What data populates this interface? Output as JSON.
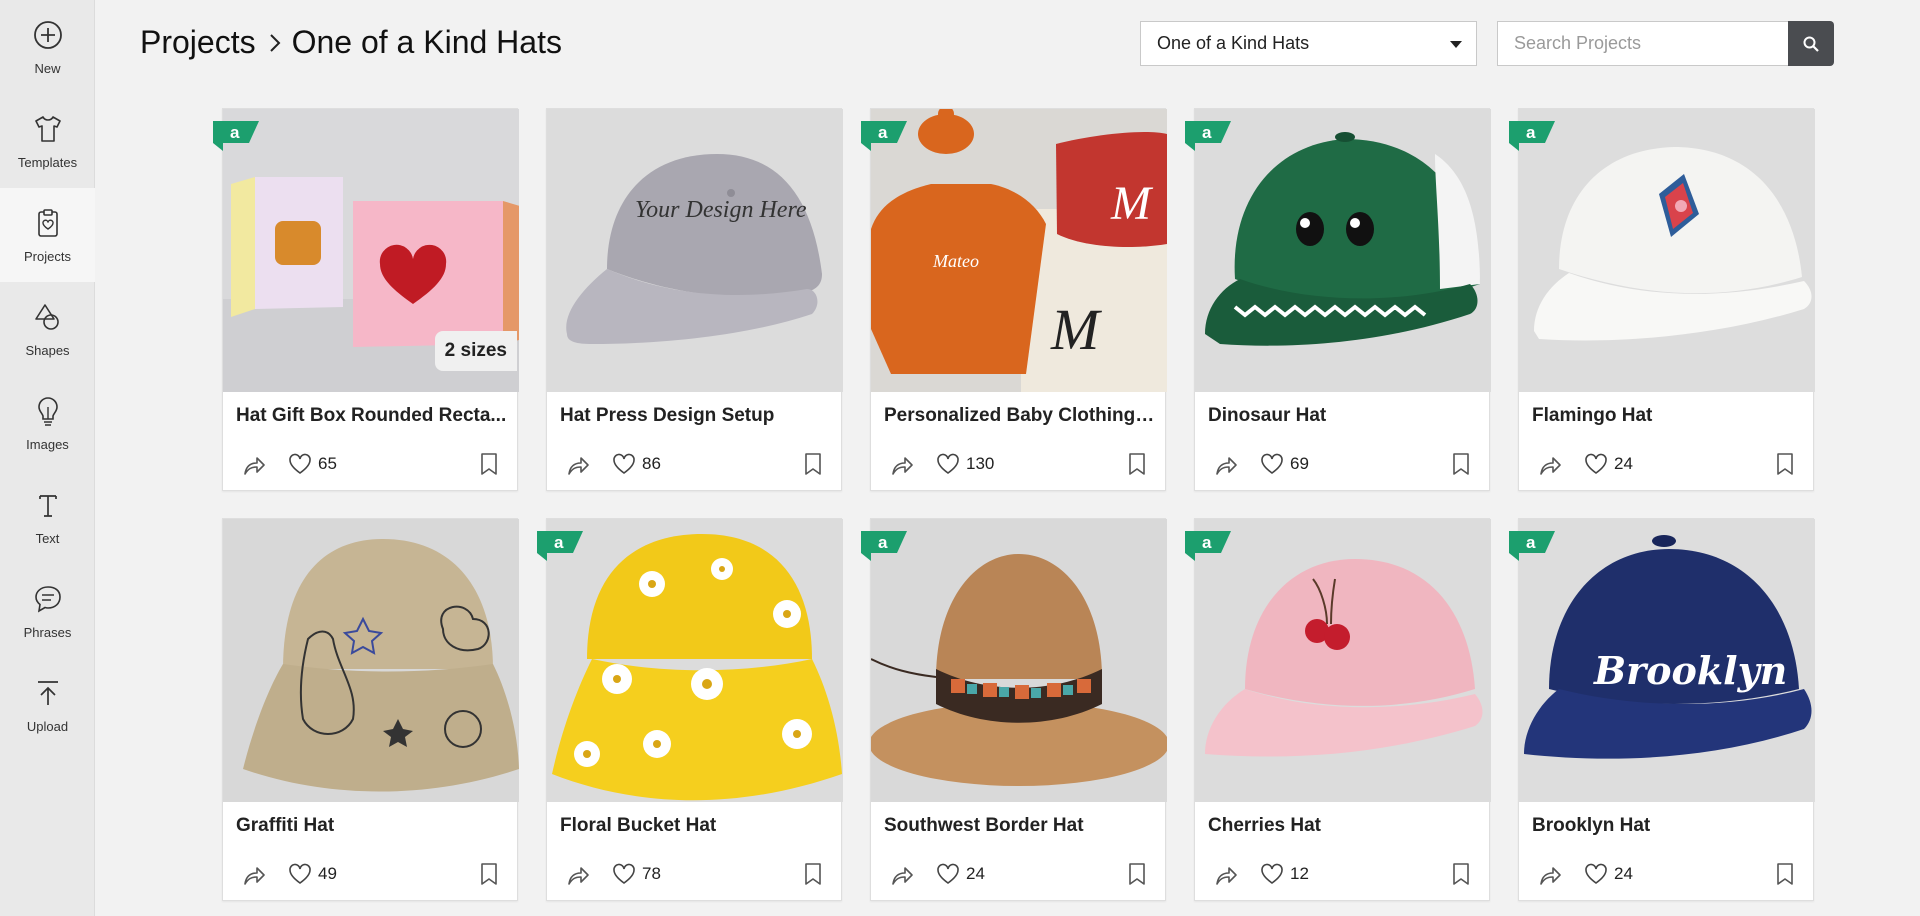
{
  "sidebar": {
    "items": [
      {
        "label": "New",
        "icon": "plus-circle-icon"
      },
      {
        "label": "Templates",
        "icon": "shirt-icon"
      },
      {
        "label": "Projects",
        "icon": "clipboard-icon",
        "active": true
      },
      {
        "label": "Shapes",
        "icon": "shapes-icon"
      },
      {
        "label": "Images",
        "icon": "lightbulb-icon"
      },
      {
        "label": "Text",
        "icon": "text-icon"
      },
      {
        "label": "Phrases",
        "icon": "speech-bubble-icon"
      },
      {
        "label": "Upload",
        "icon": "upload-icon"
      }
    ]
  },
  "header": {
    "breadcrumb_root": "Projects",
    "breadcrumb_current": "One of a Kind Hats",
    "dropdown_value": "One of a Kind Hats",
    "search_placeholder": "Search Projects"
  },
  "colors": {
    "access_badge": "#1c9f6e",
    "search_button": "#4a4c50",
    "sidebar_bg": "#e9e9e9"
  },
  "projects": [
    {
      "title": "Hat Gift Box Rounded Recta...",
      "likes": "65",
      "access_badge": true,
      "size_badge": "2 sizes"
    },
    {
      "title": "Hat Press Design Setup",
      "likes": "86",
      "access_badge": false
    },
    {
      "title": "Personalized Baby Clothing ...",
      "likes": "130",
      "access_badge": true
    },
    {
      "title": "Dinosaur Hat",
      "likes": "69",
      "access_badge": true
    },
    {
      "title": "Flamingo Hat",
      "likes": "24",
      "access_badge": true
    },
    {
      "title": "Graffiti Hat",
      "likes": "49",
      "access_badge": false
    },
    {
      "title": "Floral Bucket Hat",
      "likes": "78",
      "access_badge": true
    },
    {
      "title": "Southwest Border Hat",
      "likes": "24",
      "access_badge": true
    },
    {
      "title": "Cherries Hat",
      "likes": "12",
      "access_badge": true
    },
    {
      "title": "Brooklyn Hat",
      "likes": "24",
      "access_badge": true
    }
  ],
  "image_text": {
    "hat_press": "Your Design Here",
    "baby_name": "Mateo",
    "monogram": "M",
    "brooklyn": "Brooklyn"
  }
}
